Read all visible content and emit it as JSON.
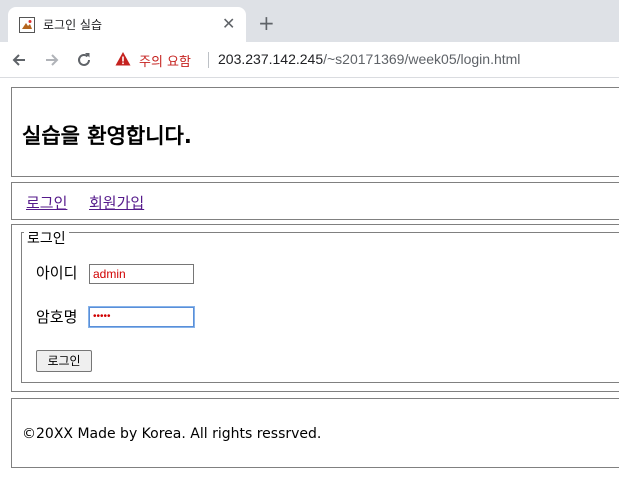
{
  "browser": {
    "tab_title": "로그인 실습",
    "close_glyph": "✕",
    "new_tab_glyph": "+",
    "security_warning": "주의 요함",
    "url_host": "203.237.142.245",
    "url_path": "/~s20171369/week05/login.html",
    "icons": {
      "back": "back-arrow-icon",
      "forward": "forward-arrow-icon",
      "reload": "reload-icon",
      "warning": "warning-triangle-icon",
      "favicon": "page-favicon-icon"
    },
    "colors": {
      "warning": "#c5221f",
      "tabstrip": "#dee1e6"
    }
  },
  "page": {
    "title": "실습을 환영합니다.",
    "nav": {
      "login_link": "로그인",
      "signup_link": "회원가입"
    },
    "form": {
      "legend": "로그인",
      "id_label": "아이디",
      "id_value": "admin",
      "password_label": "암호명",
      "password_value": "•••••",
      "submit_label": "로그인"
    },
    "footer": {
      "text": "©20XX Made by Korea. All rights ressrved."
    },
    "colors": {
      "link": "#551a8b",
      "input_text": "#d00000"
    }
  }
}
